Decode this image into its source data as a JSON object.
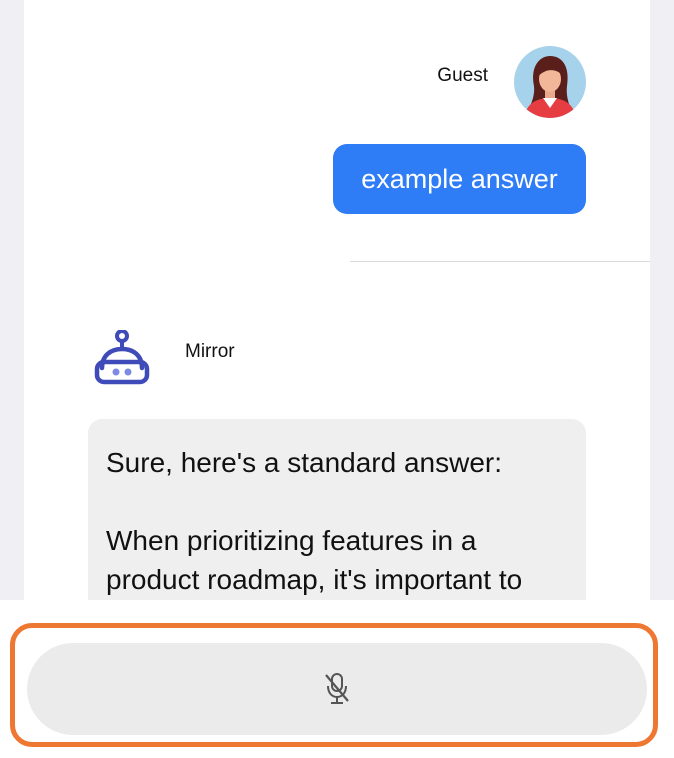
{
  "messages": [
    {
      "sender": "Guest",
      "avatar": "woman-avatar",
      "text": "example answer",
      "bubble_color": "#2e7cf6"
    },
    {
      "sender": "Mirror",
      "avatar": "robot-icon",
      "paragraphs": [
        "Sure, here's a standard answer:",
        "When prioritizing features in a product roadmap, it's important to"
      ],
      "bubble_color": "#efefef"
    }
  ],
  "input": {
    "icon": "microphone-muted-icon",
    "focus_color": "#ee7832"
  },
  "colors": {
    "accent": "#2e7cf6",
    "robot": "#3f4bb8",
    "background_gutter": "#efeff4"
  }
}
